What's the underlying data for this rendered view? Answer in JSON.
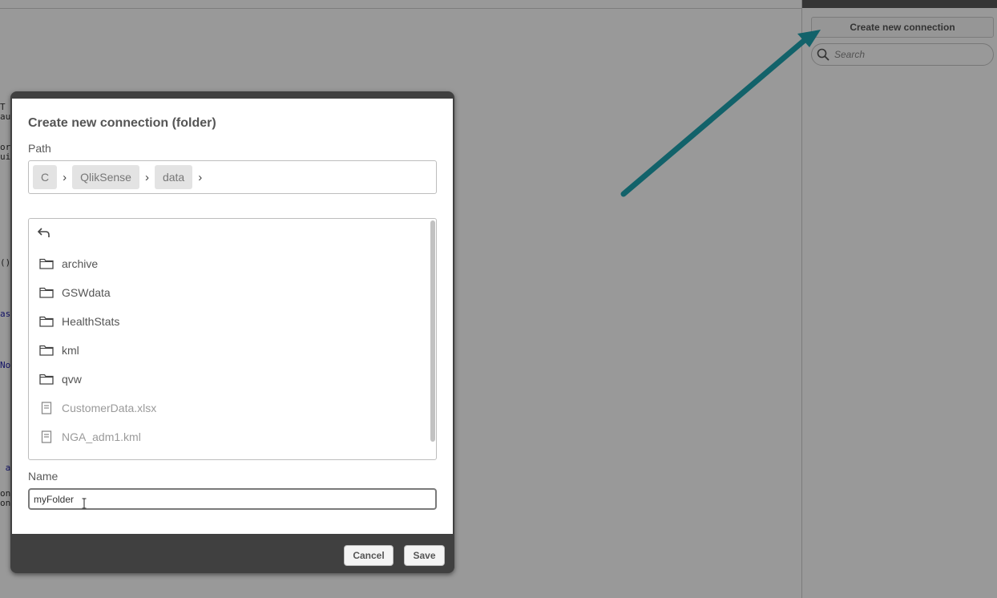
{
  "right_panel": {
    "create_connection_label": "Create new connection",
    "search_placeholder": "Search"
  },
  "dialog": {
    "title": "Create new connection (folder)",
    "path_label": "Path",
    "path_crumbs": [
      "C",
      "QlikSense",
      "data"
    ],
    "crumb_separator": "›",
    "items": [
      {
        "type": "folder",
        "name": "archive",
        "icon": "folder-icon"
      },
      {
        "type": "folder",
        "name": "GSWdata",
        "icon": "folder-icon"
      },
      {
        "type": "folder",
        "name": "HealthStats",
        "icon": "folder-icon"
      },
      {
        "type": "folder",
        "name": "kml",
        "icon": "folder-icon"
      },
      {
        "type": "folder",
        "name": "qvw",
        "icon": "folder-icon"
      },
      {
        "type": "file",
        "name": "CustomerData.xlsx",
        "icon": "file-icon"
      },
      {
        "type": "file",
        "name": "NGA_adm1.kml",
        "icon": "file-icon"
      }
    ],
    "name_label": "Name",
    "name_value": "myFolder",
    "cancel_label": "Cancel",
    "save_label": "Save"
  },
  "colors": {
    "dialog_frame": "#404040",
    "annotation_arrow": "#12626a",
    "overlay": "rgba(0,0,0,0.40)"
  }
}
